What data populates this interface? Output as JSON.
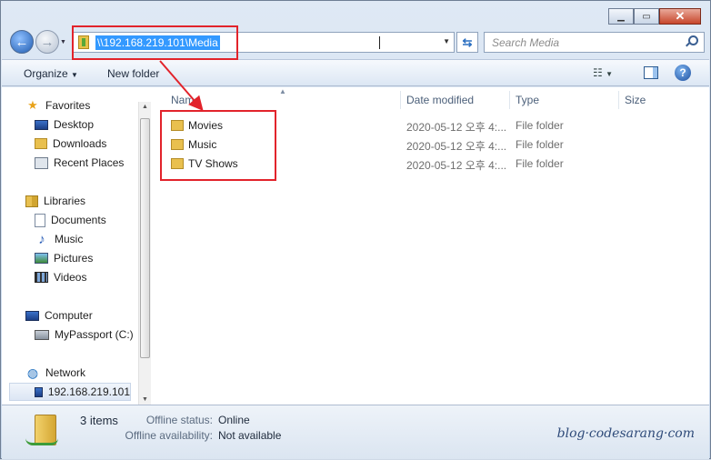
{
  "window": {
    "caption_buttons": [
      "minimize",
      "maximize",
      "close"
    ]
  },
  "address_bar": {
    "path": "\\\\192.168.219.101\\Media"
  },
  "search": {
    "placeholder": "Search Media"
  },
  "toolbar": {
    "organize_label": "Organize",
    "new_folder_label": "New folder"
  },
  "nav_pane": {
    "favorites": {
      "label": "Favorites",
      "items": [
        "Desktop",
        "Downloads",
        "Recent Places"
      ]
    },
    "libraries": {
      "label": "Libraries",
      "items": [
        "Documents",
        "Music",
        "Pictures",
        "Videos"
      ]
    },
    "computer": {
      "label": "Computer",
      "items": [
        "MyPassport (C:)"
      ]
    },
    "network": {
      "label": "Network",
      "items": [
        "192.168.219.101"
      ]
    }
  },
  "columns": {
    "name": "Name",
    "date_modified": "Date modified",
    "type": "Type",
    "size": "Size"
  },
  "files": [
    {
      "name": "Movies",
      "date": "2020-05-12 오후 4:...",
      "type": "File folder"
    },
    {
      "name": "Music",
      "date": "2020-05-12 오후 4:...",
      "type": "File folder"
    },
    {
      "name": "TV Shows",
      "date": "2020-05-12 오후 4:...",
      "type": "File folder"
    }
  ],
  "status_bar": {
    "item_count": "3 items",
    "offline_status_label": "Offline status:",
    "offline_status_value": "Online",
    "offline_availability_label": "Offline availability:",
    "offline_availability_value": "Not available"
  },
  "watermark": "blog·codesarang·com",
  "colors": {
    "highlight_box": "#e2232b",
    "selection": "#3399ff"
  }
}
